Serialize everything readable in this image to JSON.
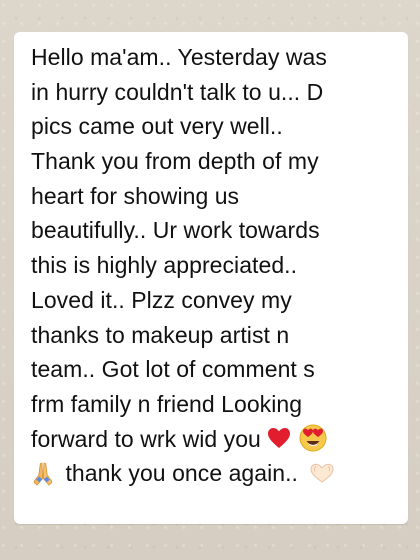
{
  "message": {
    "lines": [
      "Hello ma'am.. Yesterday was",
      "in hurry couldn't talk to u... D",
      "pics came out very well..",
      "Thank you from depth of my",
      "heart for showing us",
      "beautifully.. Ur work towards",
      "this is highly appreciated..",
      "Loved it.. Plzz convey my",
      "thanks to makeup artist n",
      "team.. Got lot of comment s",
      "frm family n friend Looking",
      "forward to wrk wid you",
      "thank you once again.. "
    ],
    "emoji_icons": [
      "red-heart-icon",
      "heart-eyes-icon",
      "praying-hands-icon",
      "heart-hands-icon"
    ]
  },
  "colors": {
    "background": "#d9d1c5",
    "bubble": "#ffffff",
    "text": "#111111",
    "heart_red": "#e11d2e",
    "emoji_yellow": "#f6c84b",
    "hands": "#f4c16f",
    "heart_hands": "#fde8d4"
  }
}
